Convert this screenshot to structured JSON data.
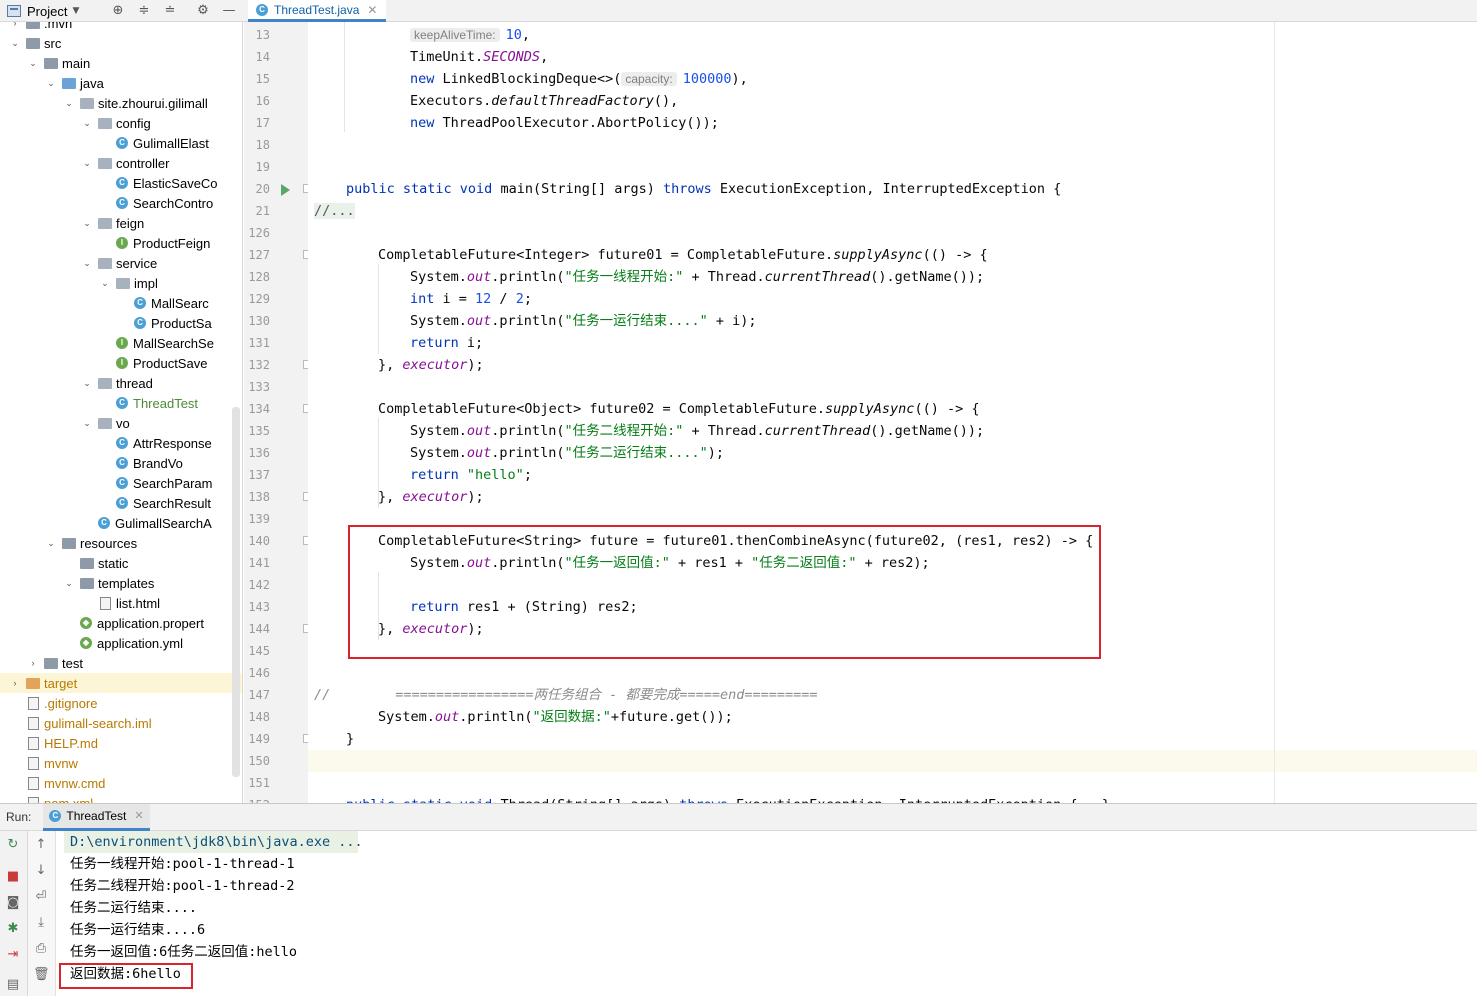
{
  "project_panel": {
    "title": "Project",
    "tree": [
      {
        "label": ".mvn",
        "depth": 2,
        "kind": "folder",
        "state": "collapsed"
      },
      {
        "label": "src",
        "depth": 2,
        "kind": "folder",
        "state": "expanded"
      },
      {
        "label": "main",
        "depth": 3,
        "kind": "folder",
        "state": "expanded"
      },
      {
        "label": "java",
        "depth": 4,
        "kind": "folder-blue",
        "state": "expanded"
      },
      {
        "label": "site.zhourui.gilimall",
        "depth": 5,
        "kind": "package",
        "state": "expanded"
      },
      {
        "label": "config",
        "depth": 6,
        "kind": "package",
        "state": "expanded"
      },
      {
        "label": "GulimallElast",
        "depth": 7,
        "kind": "class"
      },
      {
        "label": "controller",
        "depth": 6,
        "kind": "package",
        "state": "expanded"
      },
      {
        "label": "ElasticSaveCo",
        "depth": 7,
        "kind": "class"
      },
      {
        "label": "SearchContro",
        "depth": 7,
        "kind": "class"
      },
      {
        "label": "feign",
        "depth": 6,
        "kind": "package",
        "state": "expanded"
      },
      {
        "label": "ProductFeign",
        "depth": 7,
        "kind": "interface"
      },
      {
        "label": "service",
        "depth": 6,
        "kind": "package",
        "state": "expanded"
      },
      {
        "label": "impl",
        "depth": 7,
        "kind": "package",
        "state": "expanded"
      },
      {
        "label": "MallSearc",
        "depth": 8,
        "kind": "class"
      },
      {
        "label": "ProductSa",
        "depth": 8,
        "kind": "class"
      },
      {
        "label": "MallSearchSe",
        "depth": 7,
        "kind": "interface"
      },
      {
        "label": "ProductSave",
        "depth": 7,
        "kind": "interface"
      },
      {
        "label": "thread",
        "depth": 6,
        "kind": "package",
        "state": "expanded"
      },
      {
        "label": "ThreadTest",
        "depth": 7,
        "kind": "class-main",
        "color": "green"
      },
      {
        "label": "vo",
        "depth": 6,
        "kind": "package",
        "state": "expanded"
      },
      {
        "label": "AttrResponse",
        "depth": 7,
        "kind": "class"
      },
      {
        "label": "BrandVo",
        "depth": 7,
        "kind": "class"
      },
      {
        "label": "SearchParam",
        "depth": 7,
        "kind": "class"
      },
      {
        "label": "SearchResult",
        "depth": 7,
        "kind": "class"
      },
      {
        "label": "GulimallSearchA",
        "depth": 6,
        "kind": "class-main"
      },
      {
        "label": "resources",
        "depth": 4,
        "kind": "folder",
        "state": "expanded"
      },
      {
        "label": "static",
        "depth": 5,
        "kind": "folder"
      },
      {
        "label": "templates",
        "depth": 5,
        "kind": "folder",
        "state": "expanded"
      },
      {
        "label": "list.html",
        "depth": 6,
        "kind": "file"
      },
      {
        "label": "application.propert",
        "depth": 5,
        "kind": "config"
      },
      {
        "label": "application.yml",
        "depth": 5,
        "kind": "config"
      },
      {
        "label": "test",
        "depth": 3,
        "kind": "folder",
        "state": "collapsed"
      },
      {
        "label": "target",
        "depth": 2,
        "kind": "folder-orange",
        "state": "collapsed",
        "color": "orange",
        "selected": true
      },
      {
        "label": ".gitignore",
        "depth": 2,
        "kind": "file",
        "color": "orange"
      },
      {
        "label": "gulimall-search.iml",
        "depth": 2,
        "kind": "file",
        "color": "orange"
      },
      {
        "label": "HELP.md",
        "depth": 2,
        "kind": "file",
        "color": "orange"
      },
      {
        "label": "mvnw",
        "depth": 2,
        "kind": "file",
        "color": "orange"
      },
      {
        "label": "mvnw.cmd",
        "depth": 2,
        "kind": "file",
        "color": "orange"
      },
      {
        "label": "pom.xml",
        "depth": 2,
        "kind": "file",
        "color": "orange"
      }
    ]
  },
  "editor": {
    "tab_title": "ThreadTest.java",
    "lines": [
      {
        "n": "13",
        "indent": 13,
        "tokens": [
          {
            "t": "keepAliveTime:",
            "c": "hint"
          },
          {
            "t": "10",
            "c": "num"
          },
          {
            "t": ",",
            "c": ""
          }
        ]
      },
      {
        "n": "14",
        "indent": 13,
        "tokens": [
          {
            "t": "TimeUnit.",
            "c": ""
          },
          {
            "t": "SECONDS",
            "c": "field"
          },
          {
            "t": ",",
            "c": ""
          }
        ]
      },
      {
        "n": "15",
        "indent": 13,
        "tokens": [
          {
            "t": "new ",
            "c": "kw"
          },
          {
            "t": "LinkedBlockingDeque<>(",
            "c": ""
          },
          {
            "t": "capacity:",
            "c": "hint"
          },
          {
            "t": "100000",
            "c": "num"
          },
          {
            "t": "),",
            "c": ""
          }
        ]
      },
      {
        "n": "16",
        "indent": 13,
        "tokens": [
          {
            "t": "Executors.",
            "c": ""
          },
          {
            "t": "defaultThreadFactory",
            "c": "it"
          },
          {
            "t": "(),",
            "c": ""
          }
        ]
      },
      {
        "n": "17",
        "indent": 13,
        "tokens": [
          {
            "t": "new ",
            "c": "kw"
          },
          {
            "t": "ThreadPoolExecutor.AbortPolicy());",
            "c": ""
          }
        ]
      },
      {
        "n": "18",
        "indent": 0,
        "tokens": []
      },
      {
        "n": "19",
        "indent": 0,
        "tokens": []
      },
      {
        "n": "20",
        "indent": 1,
        "tokens": [
          {
            "t": "public static void ",
            "c": "kw"
          },
          {
            "t": "main(String[] args) ",
            "c": ""
          },
          {
            "t": "throws ",
            "c": "kw"
          },
          {
            "t": "ExecutionException, InterruptedException {",
            "c": ""
          }
        ]
      },
      {
        "n": "21",
        "indent": 0,
        "tokens": [
          {
            "t": "//...",
            "c": "fold"
          }
        ]
      },
      {
        "n": "126",
        "indent": 0,
        "tokens": []
      },
      {
        "n": "127",
        "indent": 2,
        "tokens": [
          {
            "t": "CompletableFuture<Integer> future01 = CompletableFuture.",
            "c": ""
          },
          {
            "t": "supplyAsync",
            "c": "it"
          },
          {
            "t": "(() -> {",
            "c": ""
          }
        ]
      },
      {
        "n": "128",
        "indent": 3,
        "tokens": [
          {
            "t": "System.",
            "c": ""
          },
          {
            "t": "out",
            "c": "field"
          },
          {
            "t": ".println(",
            "c": ""
          },
          {
            "t": "\"任务一线程开始:\"",
            "c": "str"
          },
          {
            "t": " + Thread.",
            "c": ""
          },
          {
            "t": "currentThread",
            "c": "it"
          },
          {
            "t": "().getName());",
            "c": ""
          }
        ]
      },
      {
        "n": "129",
        "indent": 3,
        "tokens": [
          {
            "t": "int ",
            "c": "kw"
          },
          {
            "t": "i = ",
            "c": ""
          },
          {
            "t": "12",
            "c": "num"
          },
          {
            "t": " / ",
            "c": ""
          },
          {
            "t": "2",
            "c": "num"
          },
          {
            "t": ";",
            "c": ""
          }
        ]
      },
      {
        "n": "130",
        "indent": 3,
        "tokens": [
          {
            "t": "System.",
            "c": ""
          },
          {
            "t": "out",
            "c": "field"
          },
          {
            "t": ".println(",
            "c": ""
          },
          {
            "t": "\"任务一运行结束....\"",
            "c": "str"
          },
          {
            "t": " + i);",
            "c": ""
          }
        ]
      },
      {
        "n": "131",
        "indent": 3,
        "tokens": [
          {
            "t": "return ",
            "c": "kw"
          },
          {
            "t": "i;",
            "c": ""
          }
        ]
      },
      {
        "n": "132",
        "indent": 2,
        "tokens": [
          {
            "t": "}, ",
            "c": ""
          },
          {
            "t": "executor",
            "c": "field"
          },
          {
            "t": ");",
            "c": ""
          }
        ]
      },
      {
        "n": "133",
        "indent": 0,
        "tokens": []
      },
      {
        "n": "134",
        "indent": 2,
        "tokens": [
          {
            "t": "CompletableFuture<Object> future02 = CompletableFuture.",
            "c": ""
          },
          {
            "t": "supplyAsync",
            "c": "it"
          },
          {
            "t": "(() -> {",
            "c": ""
          }
        ]
      },
      {
        "n": "135",
        "indent": 3,
        "tokens": [
          {
            "t": "System.",
            "c": ""
          },
          {
            "t": "out",
            "c": "field"
          },
          {
            "t": ".println(",
            "c": ""
          },
          {
            "t": "\"任务二线程开始:\"",
            "c": "str"
          },
          {
            "t": " + Thread.",
            "c": ""
          },
          {
            "t": "currentThread",
            "c": "it"
          },
          {
            "t": "().getName());",
            "c": ""
          }
        ]
      },
      {
        "n": "136",
        "indent": 3,
        "tokens": [
          {
            "t": "System.",
            "c": ""
          },
          {
            "t": "out",
            "c": "field"
          },
          {
            "t": ".println(",
            "c": ""
          },
          {
            "t": "\"任务二运行结束....\"",
            "c": "str"
          },
          {
            "t": ");",
            "c": ""
          }
        ]
      },
      {
        "n": "137",
        "indent": 3,
        "tokens": [
          {
            "t": "return ",
            "c": "kw"
          },
          {
            "t": "\"hello\"",
            "c": "str"
          },
          {
            "t": ";",
            "c": ""
          }
        ]
      },
      {
        "n": "138",
        "indent": 2,
        "tokens": [
          {
            "t": "}, ",
            "c": ""
          },
          {
            "t": "executor",
            "c": "field"
          },
          {
            "t": ");",
            "c": ""
          }
        ]
      },
      {
        "n": "139",
        "indent": 0,
        "tokens": []
      },
      {
        "n": "140",
        "indent": 2,
        "tokens": [
          {
            "t": "CompletableFuture<String> future = future01.thenCombineAsync(future02, (res1, res2) -> {",
            "c": ""
          }
        ]
      },
      {
        "n": "141",
        "indent": 3,
        "tokens": [
          {
            "t": "System.",
            "c": ""
          },
          {
            "t": "out",
            "c": "field"
          },
          {
            "t": ".println(",
            "c": ""
          },
          {
            "t": "\"任务一返回值:\"",
            "c": "str"
          },
          {
            "t": " + res1 + ",
            "c": ""
          },
          {
            "t": "\"任务二返回值:\"",
            "c": "str"
          },
          {
            "t": " + res2);",
            "c": ""
          }
        ]
      },
      {
        "n": "142",
        "indent": 0,
        "tokens": []
      },
      {
        "n": "143",
        "indent": 3,
        "tokens": [
          {
            "t": "return ",
            "c": "kw"
          },
          {
            "t": "res1 + (String) res2;",
            "c": ""
          }
        ]
      },
      {
        "n": "144",
        "indent": 2,
        "tokens": [
          {
            "t": "}, ",
            "c": ""
          },
          {
            "t": "executor",
            "c": "field"
          },
          {
            "t": ");",
            "c": ""
          }
        ]
      },
      {
        "n": "145",
        "indent": 0,
        "tokens": []
      },
      {
        "n": "146",
        "indent": 0,
        "tokens": []
      },
      {
        "n": "147",
        "indent": 0,
        "tokens": [
          {
            "t": "//        =================两任务组合 - 都要完成=====end=========",
            "c": "cmt"
          }
        ]
      },
      {
        "n": "148",
        "indent": 2,
        "tokens": [
          {
            "t": "System.",
            "c": ""
          },
          {
            "t": "out",
            "c": "field"
          },
          {
            "t": ".println(",
            "c": ""
          },
          {
            "t": "\"返回数据:\"",
            "c": "str"
          },
          {
            "t": "+future.get());",
            "c": ""
          }
        ]
      },
      {
        "n": "149",
        "indent": 1,
        "tokens": [
          {
            "t": "}",
            "c": ""
          }
        ]
      },
      {
        "n": "150",
        "indent": 0,
        "tokens": []
      },
      {
        "n": "151",
        "indent": 0,
        "tokens": []
      },
      {
        "n": "152",
        "indent": 1,
        "tokens": [
          {
            "t": "public static void ",
            "c": "kw"
          },
          {
            "t": "Thread(String[] args) ",
            "c": ""
          },
          {
            "t": "throws ",
            "c": "kw"
          },
          {
            "t": "ExecutionException, InterruptedException {...}",
            "c": ""
          }
        ]
      }
    ]
  },
  "run_panel": {
    "label": "Run:",
    "tab_title": "ThreadTest",
    "command": "D:\\environment\\jdk8\\bin\\java.exe ...",
    "output": [
      "任务一线程开始:pool-1-thread-1",
      "任务二线程开始:pool-1-thread-2",
      "任务二运行结束....",
      "任务一运行结束....6",
      "任务一返回值:6任务二返回值:hello",
      "返回数据:6hello"
    ]
  },
  "colors": {
    "keyword": "#0033b3",
    "string": "#067d17",
    "number": "#1750eb",
    "field": "#871094",
    "highlight_box": "#d9232e"
  }
}
